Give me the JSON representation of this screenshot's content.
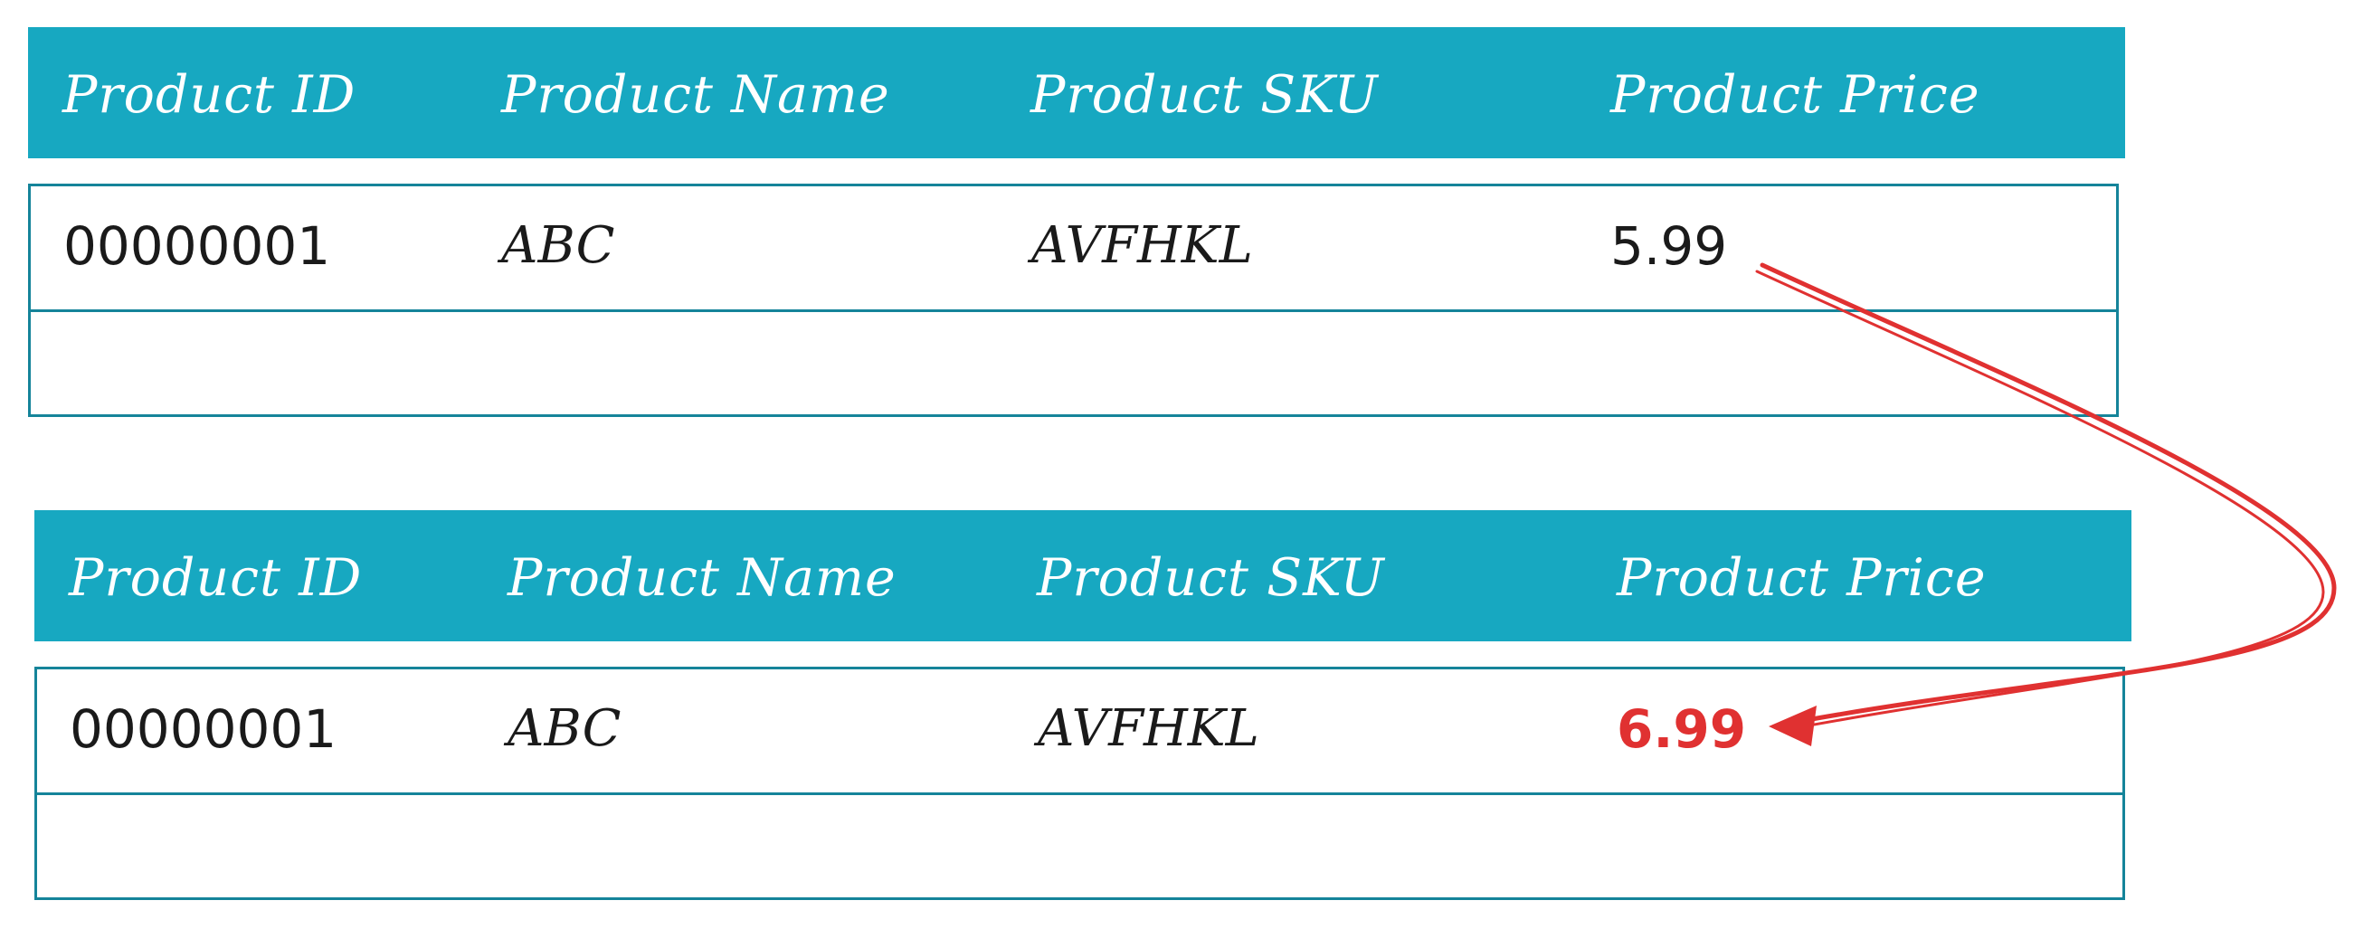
{
  "columns": [
    "Product ID",
    "Product Name",
    "Product SKU",
    "Product Price"
  ],
  "table_before": {
    "row": {
      "product_id": "00000001",
      "product_name": "ABC",
      "product_sku": "AVFHKL",
      "product_price": "5.99"
    }
  },
  "table_after": {
    "row": {
      "product_id": "00000001",
      "product_name": "ABC",
      "product_sku": "AVFHKL",
      "product_price": "6.99"
    }
  },
  "colors": {
    "header_background": "#17a8c1",
    "header_text": "#ffffff",
    "border": "#15849a",
    "text": "#1a1a1a",
    "changed_value": "#e03131",
    "arrow": "#e03131"
  }
}
